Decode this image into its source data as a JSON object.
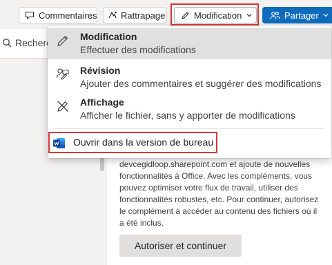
{
  "toolbar": {
    "comments_label": "Commentaires",
    "catchup_label": "Rattrapage",
    "edit_label": "Modification",
    "share_label": "Partager"
  },
  "search": {
    "text": "Recherc"
  },
  "menu": {
    "items": [
      {
        "title": "Modification",
        "description": "Effectuer des modifications",
        "icon": "pencil-icon"
      },
      {
        "title": "Révision",
        "description": "Ajouter des commentaires et suggérer des modifications",
        "icon": "review-icon"
      },
      {
        "title": "Affichage",
        "description": "Afficher le fichier, sans y apporter de modifications",
        "icon": "no-edit-icon"
      }
    ],
    "open_desktop_label": "Ouvrir dans la version de bureau"
  },
  "document": {
    "paragraph": "devcegidloop.sharepoint.com et ajoute de nouvelles fonctionnalités à Office. Avec les compléments, vous pouvez optimiser votre flux de travail, utiliser des fonctionnalités robustes, etc. Pour continuer, autorisez le complément à accéder au contenu des fichiers où il a été inclus.",
    "allow_button": "Autoriser et continuer"
  },
  "colors": {
    "accent": "#0f6cbd",
    "highlight": "#d13438",
    "word_blue": "#185abd"
  }
}
